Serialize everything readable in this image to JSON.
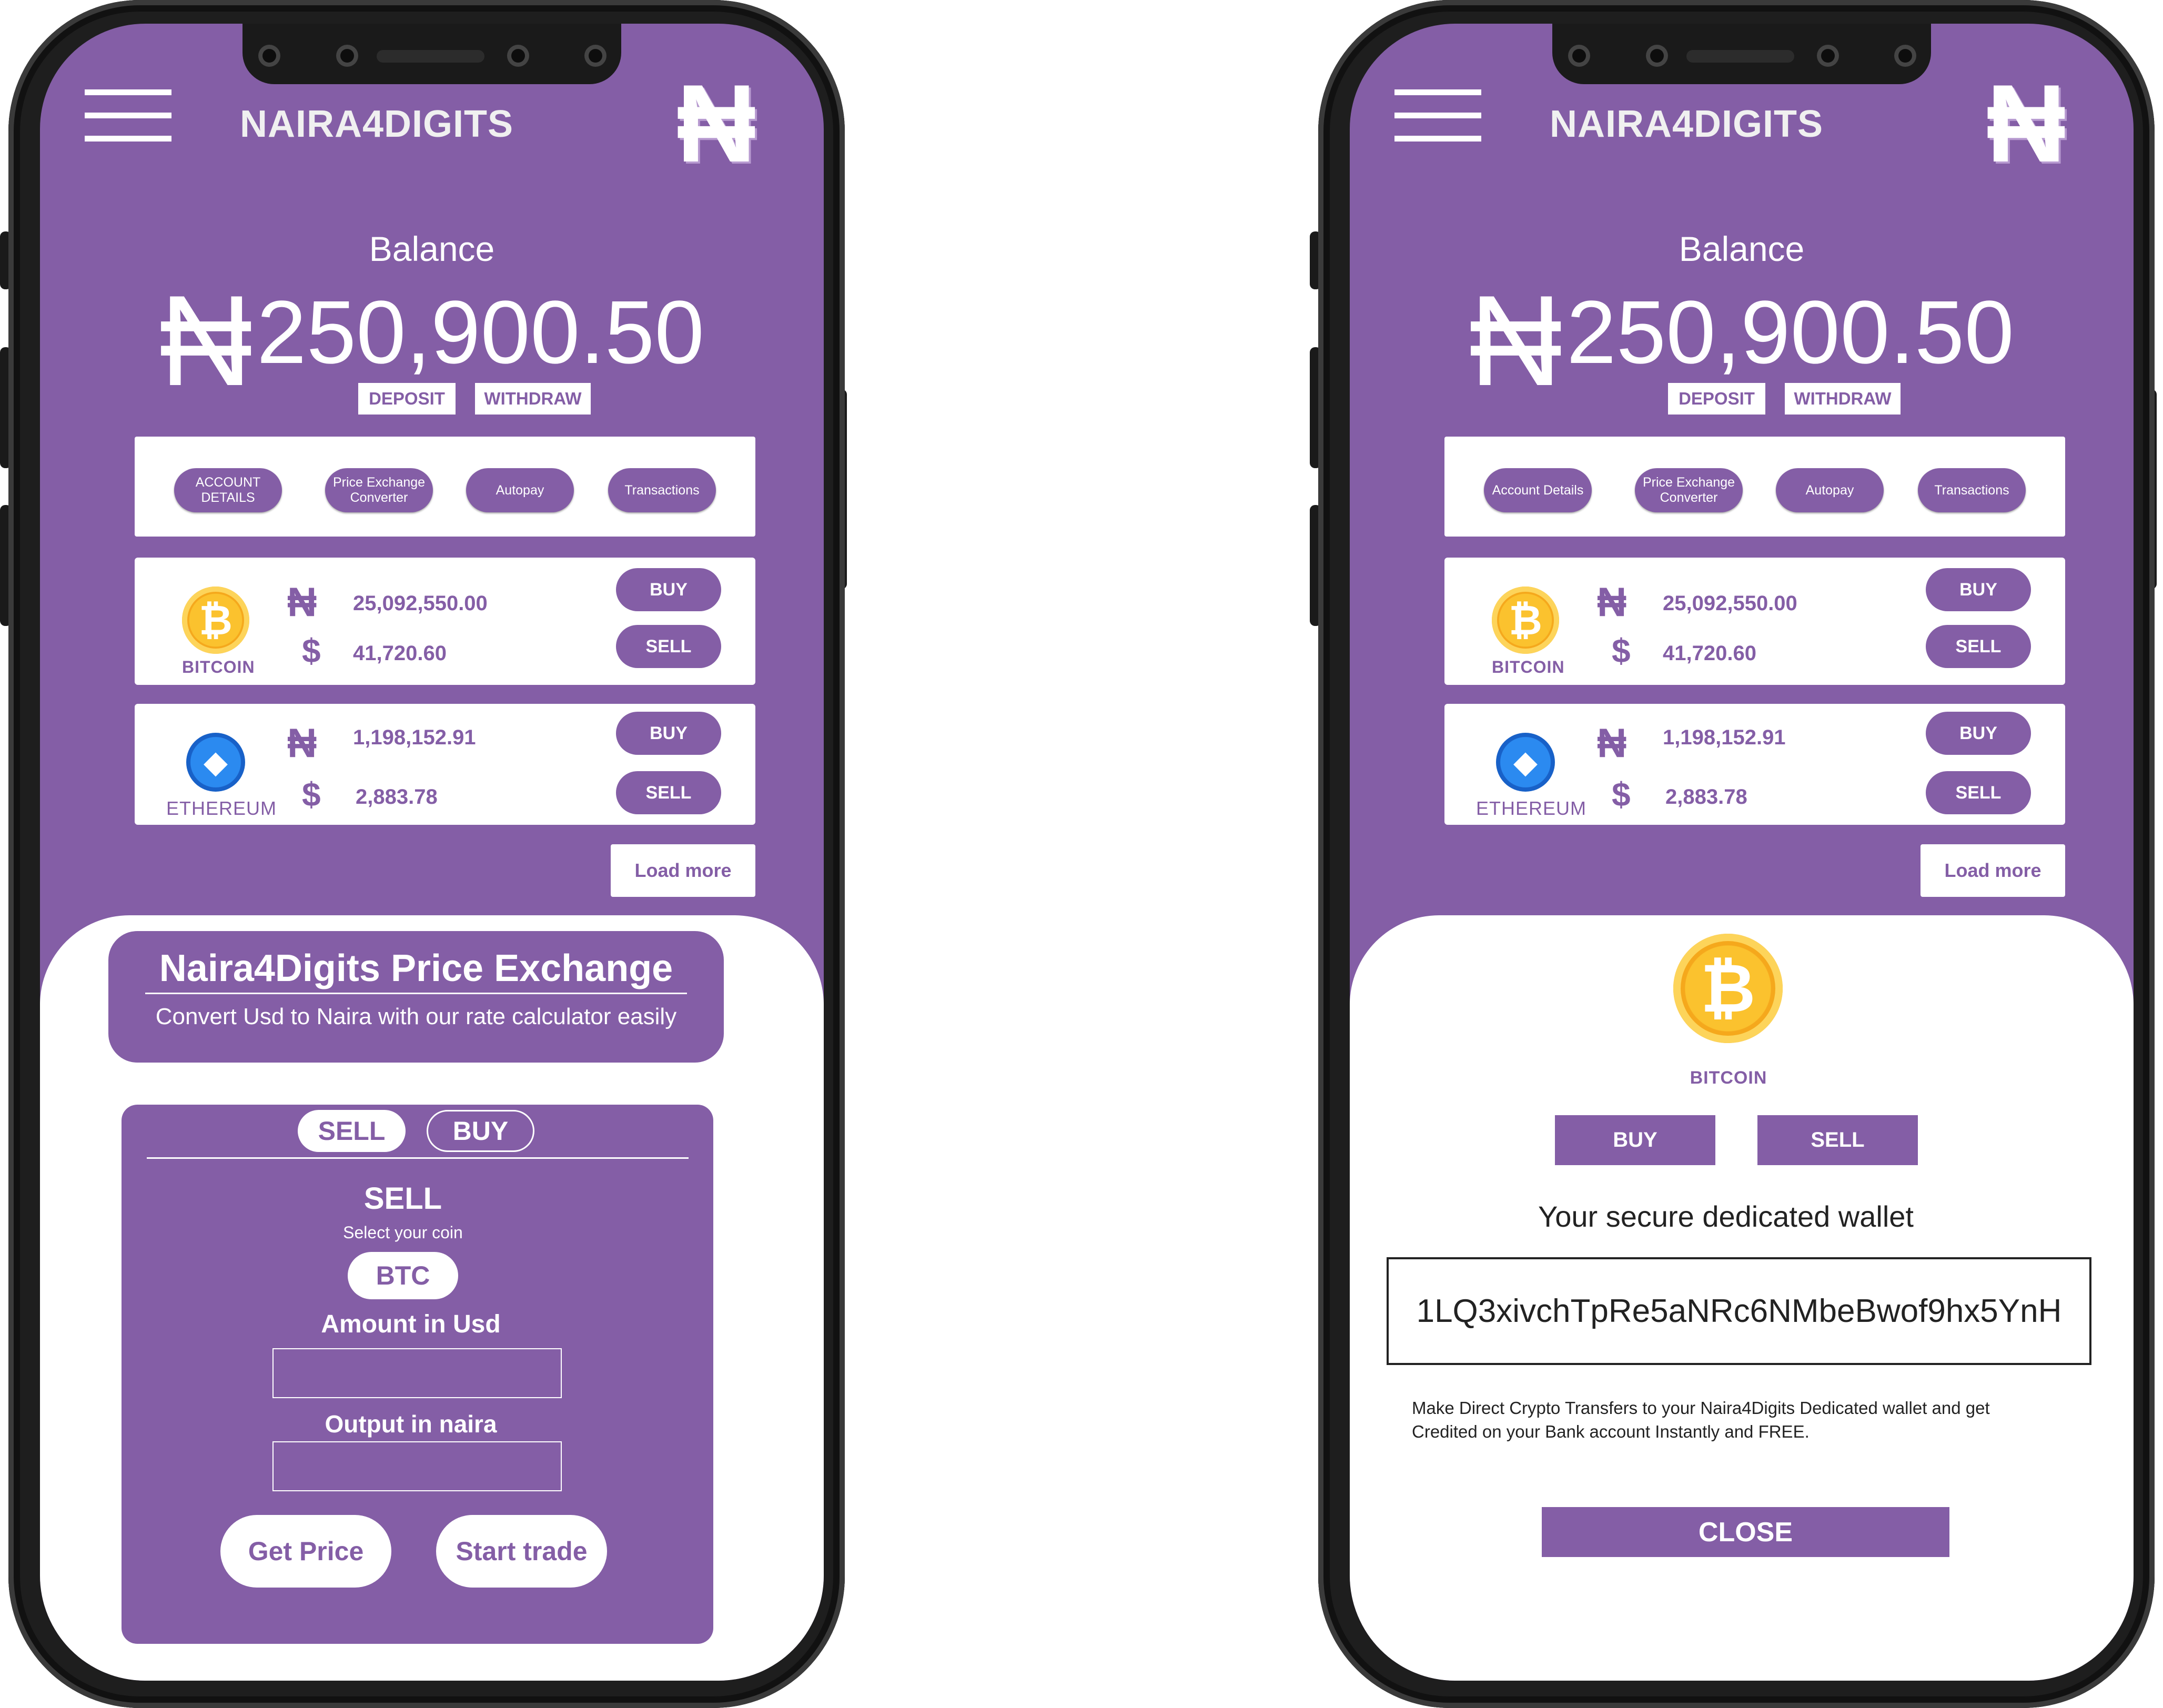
{
  "app": {
    "brand": "NAIRA4DIGITS",
    "logo_glyph": "₦",
    "accent_color": "#845ea6"
  },
  "balance": {
    "label": "Balance",
    "currency_symbol": "₦",
    "amount": "250,900.50",
    "deposit_label": "DEPOSIT",
    "withdraw_label": "WITHDRAW"
  },
  "menus": {
    "left": [
      "ACCOUNT DETAILS",
      "Price Exchange Converter",
      "Autopay",
      "Transactions"
    ],
    "right": [
      "Account Details",
      "Price Exchange Converter",
      "Autopay",
      "Transactions"
    ]
  },
  "coins": [
    {
      "name": "BITCOIN",
      "icon": "bitcoin-icon",
      "glyph": "₿",
      "naira_symbol": "₦",
      "naira_value": "25,092,550.00",
      "usd_symbol": "$",
      "usd_value": "41,720.60",
      "buy_label": "BUY",
      "sell_label": "SELL"
    },
    {
      "name": "ETHEREUM",
      "icon": "ethereum-icon",
      "glyph": "◆",
      "naira_symbol": "₦",
      "naira_value": "1,198,152.91",
      "usd_symbol": "$",
      "usd_value": "2,883.78",
      "buy_label": "BUY",
      "sell_label": "SELL"
    }
  ],
  "load_more_label": "Load more",
  "price_exchange": {
    "title": "Naira4Digits Price Exchange",
    "subtitle": "Convert Usd to Naira with our rate calculator easily",
    "tabs": [
      "SELL",
      "BUY"
    ],
    "heading": "SELL",
    "select_label": "Select your coin",
    "selected_coin": "BTC",
    "amount_label": "Amount in Usd",
    "amount_value": "",
    "output_label": "Output in naira",
    "output_value": "",
    "get_price_label": "Get Price",
    "start_trade_label": "Start trade"
  },
  "wallet_modal": {
    "coin_glyph": "₿",
    "coin_name": "BITCOIN",
    "buy_label": "BUY",
    "sell_label": "SELL",
    "wallet_label": "Your secure dedicated wallet",
    "wallet_address": "1LQ3xivchTpRe5aNRc6NMbeBwof9hx5YnH",
    "note_line1": "Make Direct Crypto Transfers to your Naira4Digits Dedicated wallet and get",
    "note_line2": "Credited on your Bank account Instantly and FREE.",
    "close_label": "CLOSE"
  }
}
